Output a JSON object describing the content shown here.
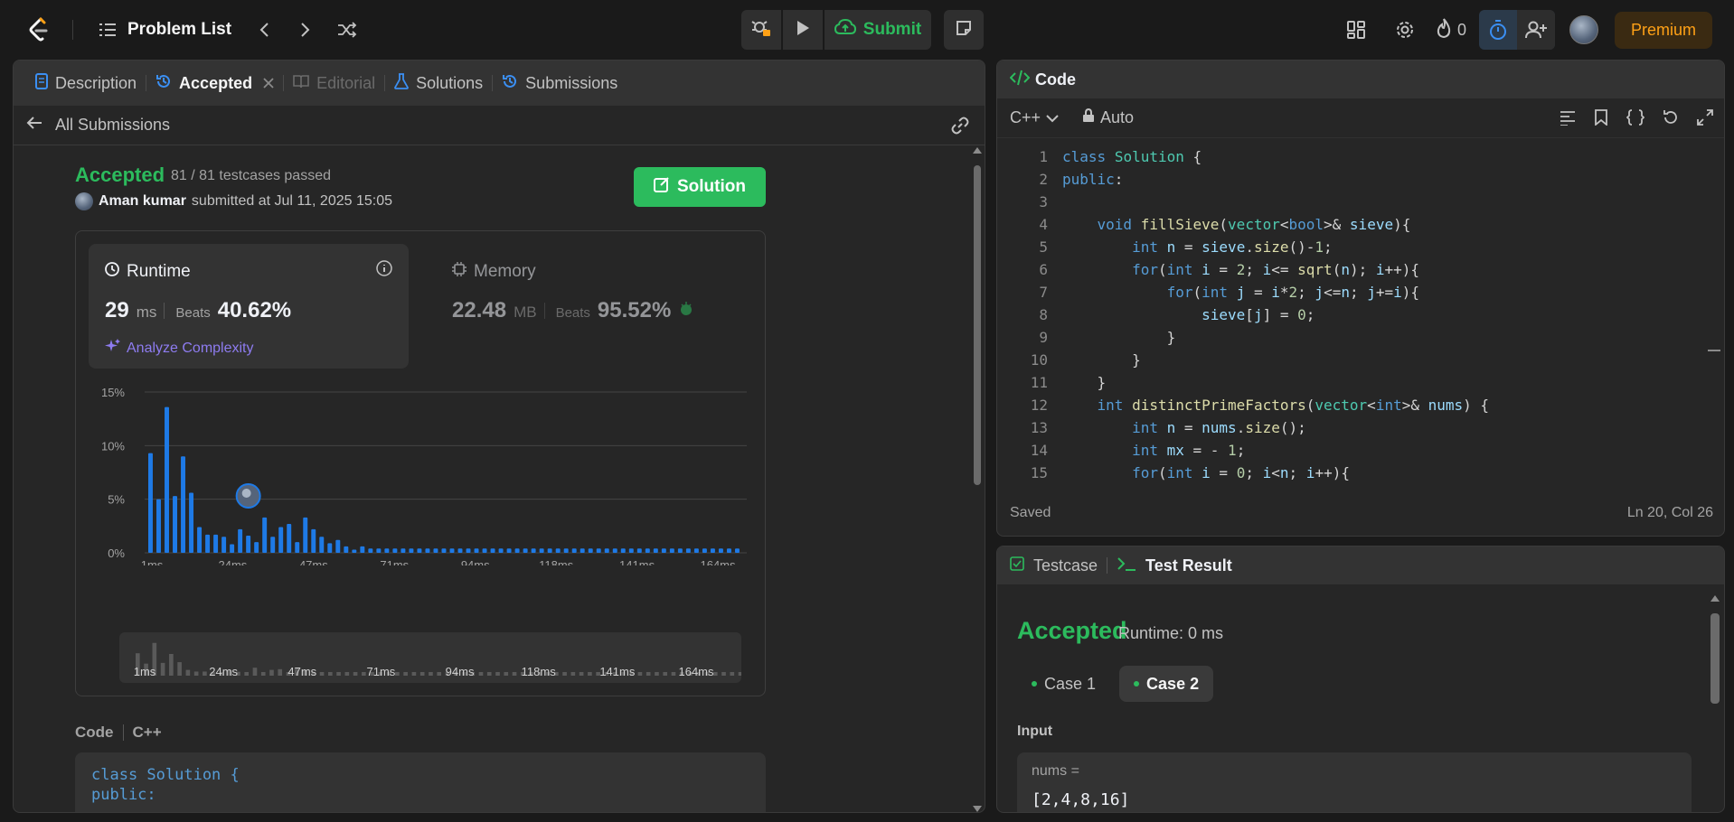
{
  "topbar": {
    "problem_list": "Problem List",
    "submit_label": "Submit",
    "streak_count": "0",
    "premium_label": "Premium"
  },
  "left": {
    "tabs": [
      {
        "label": "Description"
      },
      {
        "label": "Accepted"
      },
      {
        "label": "Editorial"
      },
      {
        "label": "Solutions"
      },
      {
        "label": "Submissions"
      }
    ],
    "back_label": "All Submissions",
    "status": "Accepted",
    "testcases": "81 / 81 testcases passed",
    "user": "Aman kumar",
    "submitted_at": "submitted at Jul 11, 2025 15:05",
    "solution_btn": "Solution",
    "runtime": {
      "title": "Runtime",
      "value": "29",
      "unit": "ms",
      "beats_label": "Beats",
      "beats": "40.62%",
      "analyze": "Analyze Complexity"
    },
    "memory": {
      "title": "Memory",
      "value": "22.48",
      "unit": "MB",
      "beats_label": "Beats",
      "beats": "95.52%"
    },
    "code_label": "Code",
    "code_lang": "C++",
    "code_snippet": [
      "class Solution {",
      "public:"
    ]
  },
  "chart_data": {
    "type": "bar",
    "yticks": [
      "15%",
      "10%",
      "5%",
      "0%"
    ],
    "ylim": [
      0,
      15
    ],
    "xticks": [
      "1ms",
      "24ms",
      "47ms",
      "71ms",
      "94ms",
      "118ms",
      "141ms",
      "164ms"
    ],
    "values": [
      9.3,
      5.0,
      13.6,
      5.3,
      9.0,
      5.6,
      2.4,
      1.7,
      1.7,
      1.5,
      0.8,
      2.2,
      1.6,
      1.0,
      3.3,
      1.5,
      2.4,
      2.7,
      1.0,
      3.3,
      2.2,
      1.5,
      0.9,
      1.2,
      0.6,
      0.3,
      0.6,
      0.4,
      0.4,
      0.4,
      0.4,
      0.4,
      0.4,
      0.4,
      0.4,
      0.4,
      0.4,
      0.4,
      0.4,
      0.4,
      0.4,
      0.4,
      0.4,
      0.4,
      0.4,
      0.4,
      0.4,
      0.4,
      0.4,
      0.4,
      0.4,
      0.4,
      0.4,
      0.4,
      0.4,
      0.4,
      0.4,
      0.4,
      0.4,
      0.4,
      0.4,
      0.4,
      0.4,
      0.4,
      0.4,
      0.4,
      0.4,
      0.4,
      0.4,
      0.4,
      0.4,
      0.4,
      0.4
    ],
    "highlight_index": 12,
    "bar_color": "#1e7ae6"
  },
  "code": {
    "title": "Code",
    "lang": "C++",
    "mode": "Auto",
    "saved": "Saved",
    "cursor": "Ln 20, Col 26",
    "lines": [
      "class Solution {",
      "public:",
      "",
      "    void fillSieve(vector<bool>& sieve){",
      "        int n = sieve.size()-1;",
      "        for(int i = 2; i<= sqrt(n); i++){",
      "            for(int j = i*2; j<=n; j+=i){",
      "                sieve[j] = 0;",
      "            }",
      "        }",
      "    }",
      "    int distinctPrimeFactors(vector<int>& nums) {",
      "        int n = nums.size();",
      "        int mx = - 1;",
      "        for(int i = 0; i<n; i++){"
    ]
  },
  "tests": {
    "tab_testcase": "Testcase",
    "tab_result": "Test Result",
    "status": "Accepted",
    "runtime": "Runtime: 0 ms",
    "cases": [
      "Case 1",
      "Case 2"
    ],
    "input_label": "Input",
    "input_name": "nums =",
    "input_value": "[2,4,8,16]"
  },
  "colors": {
    "accent_green": "#2cbb5d",
    "bar_blue": "#1e7ae6",
    "premium": "#ffa116"
  }
}
